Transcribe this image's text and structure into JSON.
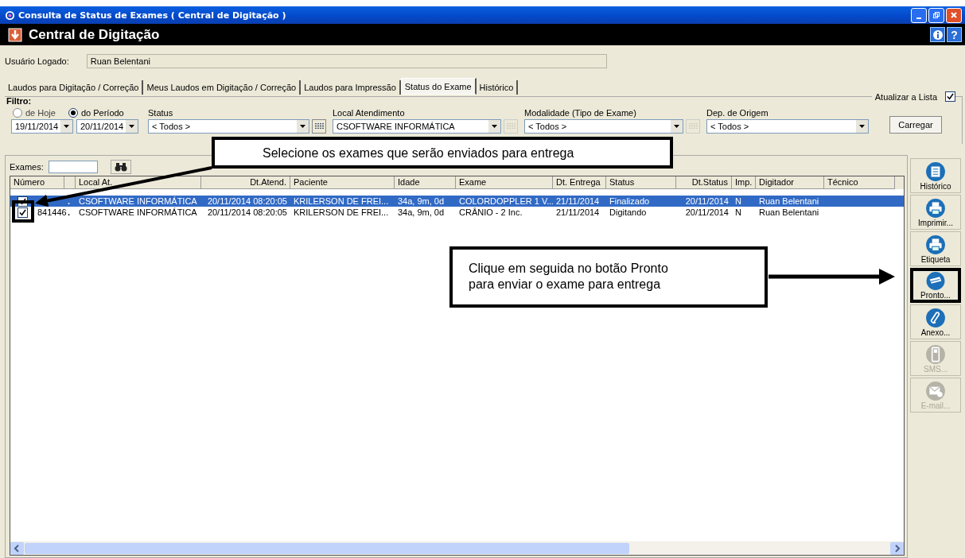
{
  "window": {
    "title": "Consulta de Status de Exames ( Central de Digitação )"
  },
  "header": {
    "title": "Central de Digitação",
    "help": "?"
  },
  "user": {
    "label": "Usuário Logado:",
    "value": "Ruan Belentani"
  },
  "tabs": [
    {
      "label": "Laudos para Digitação / Correção",
      "selected": false
    },
    {
      "label": "Meus Laudos em Digitação / Correção",
      "selected": false
    },
    {
      "label": "Laudos para Impressão",
      "selected": false
    },
    {
      "label": "Status do Exame",
      "selected": true
    },
    {
      "label": "Histórico",
      "selected": false
    }
  ],
  "filter": {
    "title": "Filtro:",
    "periods": [
      {
        "label": "de Hoje",
        "selected": false
      },
      {
        "label": "do Período",
        "selected": true
      }
    ],
    "date_from": "19/11/2014",
    "date_to": "20/11/2014",
    "combos": [
      {
        "label": "Status",
        "value": "< Todos >",
        "picker": true,
        "picker_disabled": false
      },
      {
        "label": "Local Atendimento",
        "value": "CSOFTWARE INFORMÁTICA",
        "picker": true,
        "picker_disabled": true
      },
      {
        "label": "Modalidade (Tipo de Exame)",
        "value": "< Todos >",
        "picker": true,
        "picker_disabled": true
      },
      {
        "label": "Dep. de Origem",
        "value": "< Todos >",
        "picker": false
      }
    ],
    "refresh": {
      "label": "Atualizar a Lista",
      "checked": true
    },
    "load_button": "Carregar"
  },
  "exams": {
    "label": "Exames:"
  },
  "table": {
    "columns": [
      "Número",
      "Local At.",
      "Dt.Atend.",
      "Paciente",
      "Idade",
      "Exame",
      "Dt. Entrega",
      "Status",
      "Dt.Status",
      "Imp.",
      "Digitador",
      "Técnico"
    ],
    "rows": [
      {
        "checked": true,
        "selected": true,
        "marker": ".",
        "local": "CSOFTWARE INFORMÁTICA",
        "dt_atend": "20/11/2014 08:20:05",
        "paciente": "KRILERSON DE FREI...",
        "idade": "34a, 9m, 0d",
        "exame": "COLORDOPPLER 1 V...",
        "dt_entrega": "21/11/2014",
        "status": "Finalizado",
        "dt_status": "20/11/2014",
        "imp": "N",
        "digitador": "Ruan Belentani"
      },
      {
        "checked": true,
        "selected": false,
        "numero": "841446",
        "marker": ".",
        "local": "CSOFTWARE INFORMÁTICA",
        "dt_atend": "20/11/2014 08:20:05",
        "paciente": "KRILERSON DE FREI...",
        "idade": "34a, 9m, 0d",
        "exame": "CRÂNIO - 2 Inc.",
        "dt_entrega": "21/11/2014",
        "status": "Digitando",
        "dt_status": "20/11/2014",
        "imp": "N",
        "digitador": "Ruan Belentani"
      }
    ]
  },
  "toolbar": [
    {
      "label": "Histórico",
      "kind": "list",
      "disabled": false,
      "highlighted": false
    },
    {
      "label": "Imprimir...",
      "kind": "printer",
      "disabled": false,
      "highlighted": false
    },
    {
      "label": "Etiqueta",
      "kind": "printer",
      "disabled": false,
      "highlighted": false
    },
    {
      "label": "Pronto...",
      "kind": "card",
      "disabled": false,
      "highlighted": true
    },
    {
      "label": "Anexo...",
      "kind": "clip",
      "disabled": false,
      "highlighted": false
    },
    {
      "label": "SMS...",
      "kind": "phone",
      "disabled": true,
      "highlighted": false
    },
    {
      "label": "E-mail...",
      "kind": "mail",
      "disabled": true,
      "highlighted": false
    }
  ],
  "callouts": [
    {
      "text": "Selecione os exames que serão enviados para entrega"
    },
    {
      "text": "Clique em seguida no botão Pronto para enviar o exame para entrega"
    }
  ]
}
